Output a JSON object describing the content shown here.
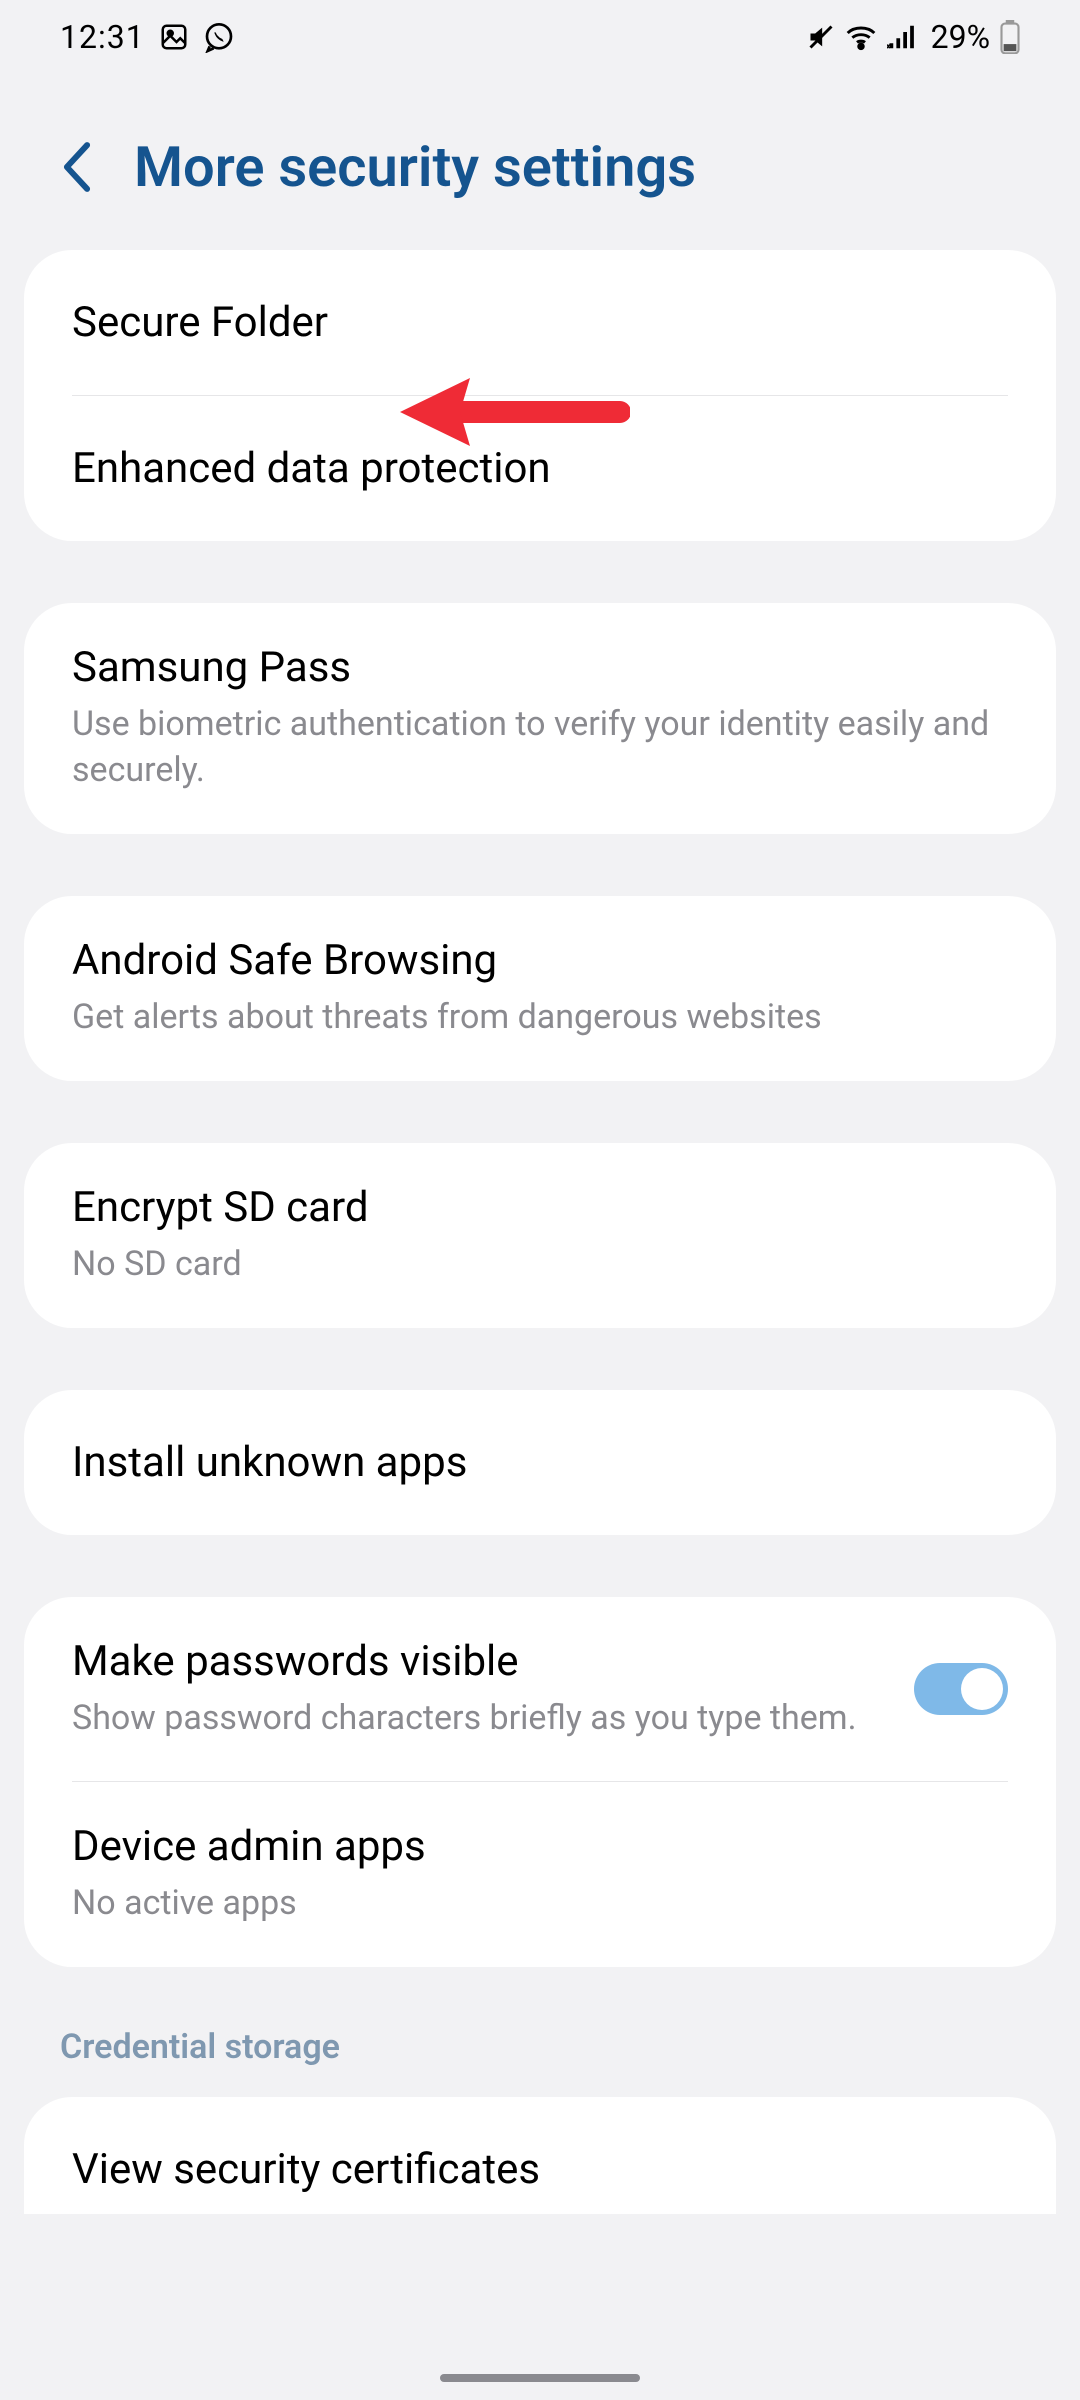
{
  "status": {
    "time": "12:31",
    "battery_pct": "29%"
  },
  "header": {
    "title": "More security settings"
  },
  "groups": [
    {
      "rows": [
        {
          "title": "Secure Folder"
        },
        {
          "title": "Enhanced data protection"
        }
      ]
    },
    {
      "rows": [
        {
          "title": "Samsung Pass",
          "sub": "Use biometric authentication to verify your identity easily and securely."
        }
      ]
    },
    {
      "rows": [
        {
          "title": "Android Safe Browsing",
          "sub": "Get alerts about threats from dangerous websites"
        }
      ]
    },
    {
      "rows": [
        {
          "title": "Encrypt SD card",
          "sub": "No SD card"
        }
      ]
    },
    {
      "rows": [
        {
          "title": "Install unknown apps"
        }
      ]
    },
    {
      "rows": [
        {
          "title": "Make passwords visible",
          "sub": "Show password characters briefly as you type them.",
          "toggle": true
        },
        {
          "title": "Device admin apps",
          "sub": "No active apps"
        }
      ]
    }
  ],
  "section_label": "Credential storage",
  "peek_row": {
    "title": "View security certificates"
  }
}
